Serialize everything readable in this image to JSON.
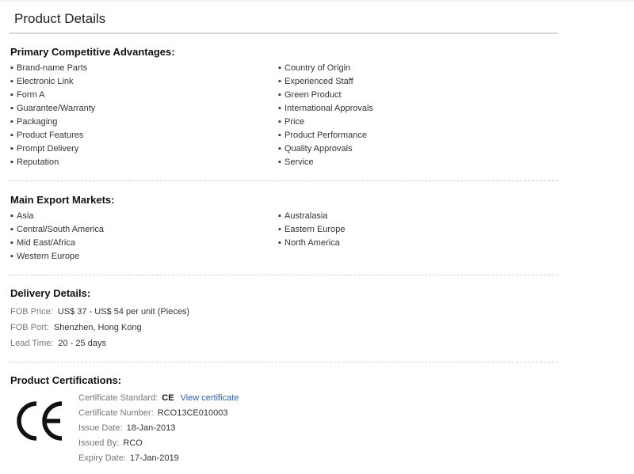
{
  "page_title": "Product Details",
  "advantages": {
    "heading": "Primary Competitive Advantages:",
    "left": [
      "Brand-name Parts",
      "Electronic Link",
      "Form A",
      "Guarantee/Warranty",
      "Packaging",
      "Product Features",
      "Prompt Delivery",
      "Reputation"
    ],
    "right": [
      "Country of Origin",
      "Experienced Staff",
      "Green Product",
      "International Approvals",
      "Price",
      "Product Performance",
      "Quality Approvals",
      "Service"
    ]
  },
  "markets": {
    "heading": "Main Export Markets:",
    "left": [
      "Asia",
      "Central/South America",
      "Mid East/Africa",
      "Western Europe"
    ],
    "right": [
      "Australasia",
      "Eastern Europe",
      "North America"
    ]
  },
  "delivery": {
    "heading": "Delivery Details:",
    "fob_price_label": "FOB Price:",
    "fob_price_value": "US$ 37 - US$ 54 per unit (Pieces)",
    "fob_port_label": "FOB Port:",
    "fob_port_value": "Shenzhen, Hong Kong",
    "lead_time_label": "Lead Time:",
    "lead_time_value": "20 - 25 days"
  },
  "certifications": {
    "heading": "Product Certifications:",
    "logo_text": "CE",
    "standard_label": "Certificate Standard:",
    "standard_value": "CE",
    "view_link": "View certificate",
    "number_label": "Certificate Number:",
    "number_value": "RCO13CE010003",
    "issue_date_label": "Issue Date:",
    "issue_date_value": "18-Jan-2013",
    "issued_by_label": "Issued By:",
    "issued_by_value": "RCO",
    "expiry_date_label": "Expiry Date:",
    "expiry_date_value": "17-Jan-2019"
  },
  "colors": {
    "link": "#2a62b8",
    "label_gray": "#777777",
    "text": "#333333",
    "rule": "#d8d8d8"
  }
}
